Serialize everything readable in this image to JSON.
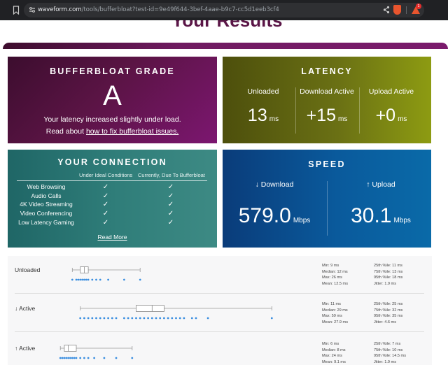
{
  "browser": {
    "url_host": "waveform.com",
    "url_path": "/tools/bufferbloat?test-id=9e49f644-3bef-4aae-b9c7-cc5d1eeb3cf4",
    "ext_badge": "1"
  },
  "page": {
    "heading": "Your Results"
  },
  "grade": {
    "title": "BUFFERBLOAT GRADE",
    "letter": "A",
    "message": "Your latency increased slightly under load.",
    "read_prefix": "Read about ",
    "read_link": "how to fix bufferbloat issues."
  },
  "latency": {
    "title": "LATENCY",
    "items": [
      {
        "label": "Unloaded",
        "value": "13",
        "unit": "ms"
      },
      {
        "label": "Download Active",
        "value": "+15",
        "unit": "ms"
      },
      {
        "label": "Upload Active",
        "value": "+0",
        "unit": "ms"
      }
    ]
  },
  "connection": {
    "title": "YOUR CONNECTION",
    "col_ideal": "Under Ideal Conditions",
    "col_current": "Currently, Due To Bufferbloat",
    "check": "✓",
    "rows": [
      {
        "name": "Web Browsing",
        "ideal": true,
        "current": true
      },
      {
        "name": "Audio Calls",
        "ideal": true,
        "current": true
      },
      {
        "name": "4K Video Streaming",
        "ideal": true,
        "current": true
      },
      {
        "name": "Video Conferencing",
        "ideal": true,
        "current": true
      },
      {
        "name": "Low Latency Gaming",
        "ideal": true,
        "current": true
      }
    ],
    "read_more": "Read More"
  },
  "speed": {
    "title": "SPEED",
    "download": {
      "label": "↓ Download",
      "value": "579.0",
      "unit": "Mbps"
    },
    "upload": {
      "label": "↑ Upload",
      "value": "30.1",
      "unit": "Mbps"
    }
  },
  "stats": [
    {
      "label": "Unloaded",
      "left": [
        "Min: 9 ms",
        "Median: 12 ms",
        "Max: 26 ms",
        "Mean: 12.5 ms"
      ],
      "right": [
        "25th %ile: 11 ms",
        "75th %ile: 13 ms",
        "95th %ile: 18 ms",
        "Jitter: 1.9 ms"
      ],
      "box": {
        "min": 9,
        "q1": 11,
        "median": 12,
        "q3": 13,
        "max": 26
      },
      "points": [
        9,
        10,
        10.5,
        11,
        11.5,
        12,
        12.5,
        13,
        14,
        15,
        16,
        18,
        22,
        26
      ]
    },
    {
      "label": "↓ Active",
      "left": [
        "Min: 11 ms",
        "Median: 29 ms",
        "Max: 59 ms",
        "Mean: 27.9 ms"
      ],
      "right": [
        "25th %ile: 25 ms",
        "75th %ile: 32 ms",
        "95th %ile: 35 ms",
        "Jitter: 4.6 ms"
      ],
      "box": {
        "min": 11,
        "q1": 25,
        "median": 29,
        "q3": 32,
        "max": 59
      },
      "points": [
        11,
        12,
        13,
        14,
        15,
        16,
        17,
        18,
        19,
        20,
        22,
        23,
        24,
        25,
        26,
        27,
        28,
        29,
        30,
        31,
        32,
        33,
        34,
        35,
        36,
        37,
        39,
        40,
        43,
        59
      ]
    },
    {
      "label": "↑ Active",
      "left": [
        "Min: 6 ms",
        "Median: 8 ms",
        "Max: 24 ms",
        "Mean: 9.1 ms"
      ],
      "right": [
        "25th %ile: 7 ms",
        "75th %ile: 10 ms",
        "95th %ile: 14.5 ms",
        "Jitter: 1.9 ms"
      ],
      "box": {
        "min": 6,
        "q1": 7,
        "median": 8,
        "q3": 10,
        "max": 24
      },
      "points": [
        6,
        6.5,
        7,
        7.5,
        8,
        8.5,
        9,
        9.5,
        10,
        11,
        12,
        13,
        14.5,
        17,
        20,
        24
      ]
    }
  ]
}
